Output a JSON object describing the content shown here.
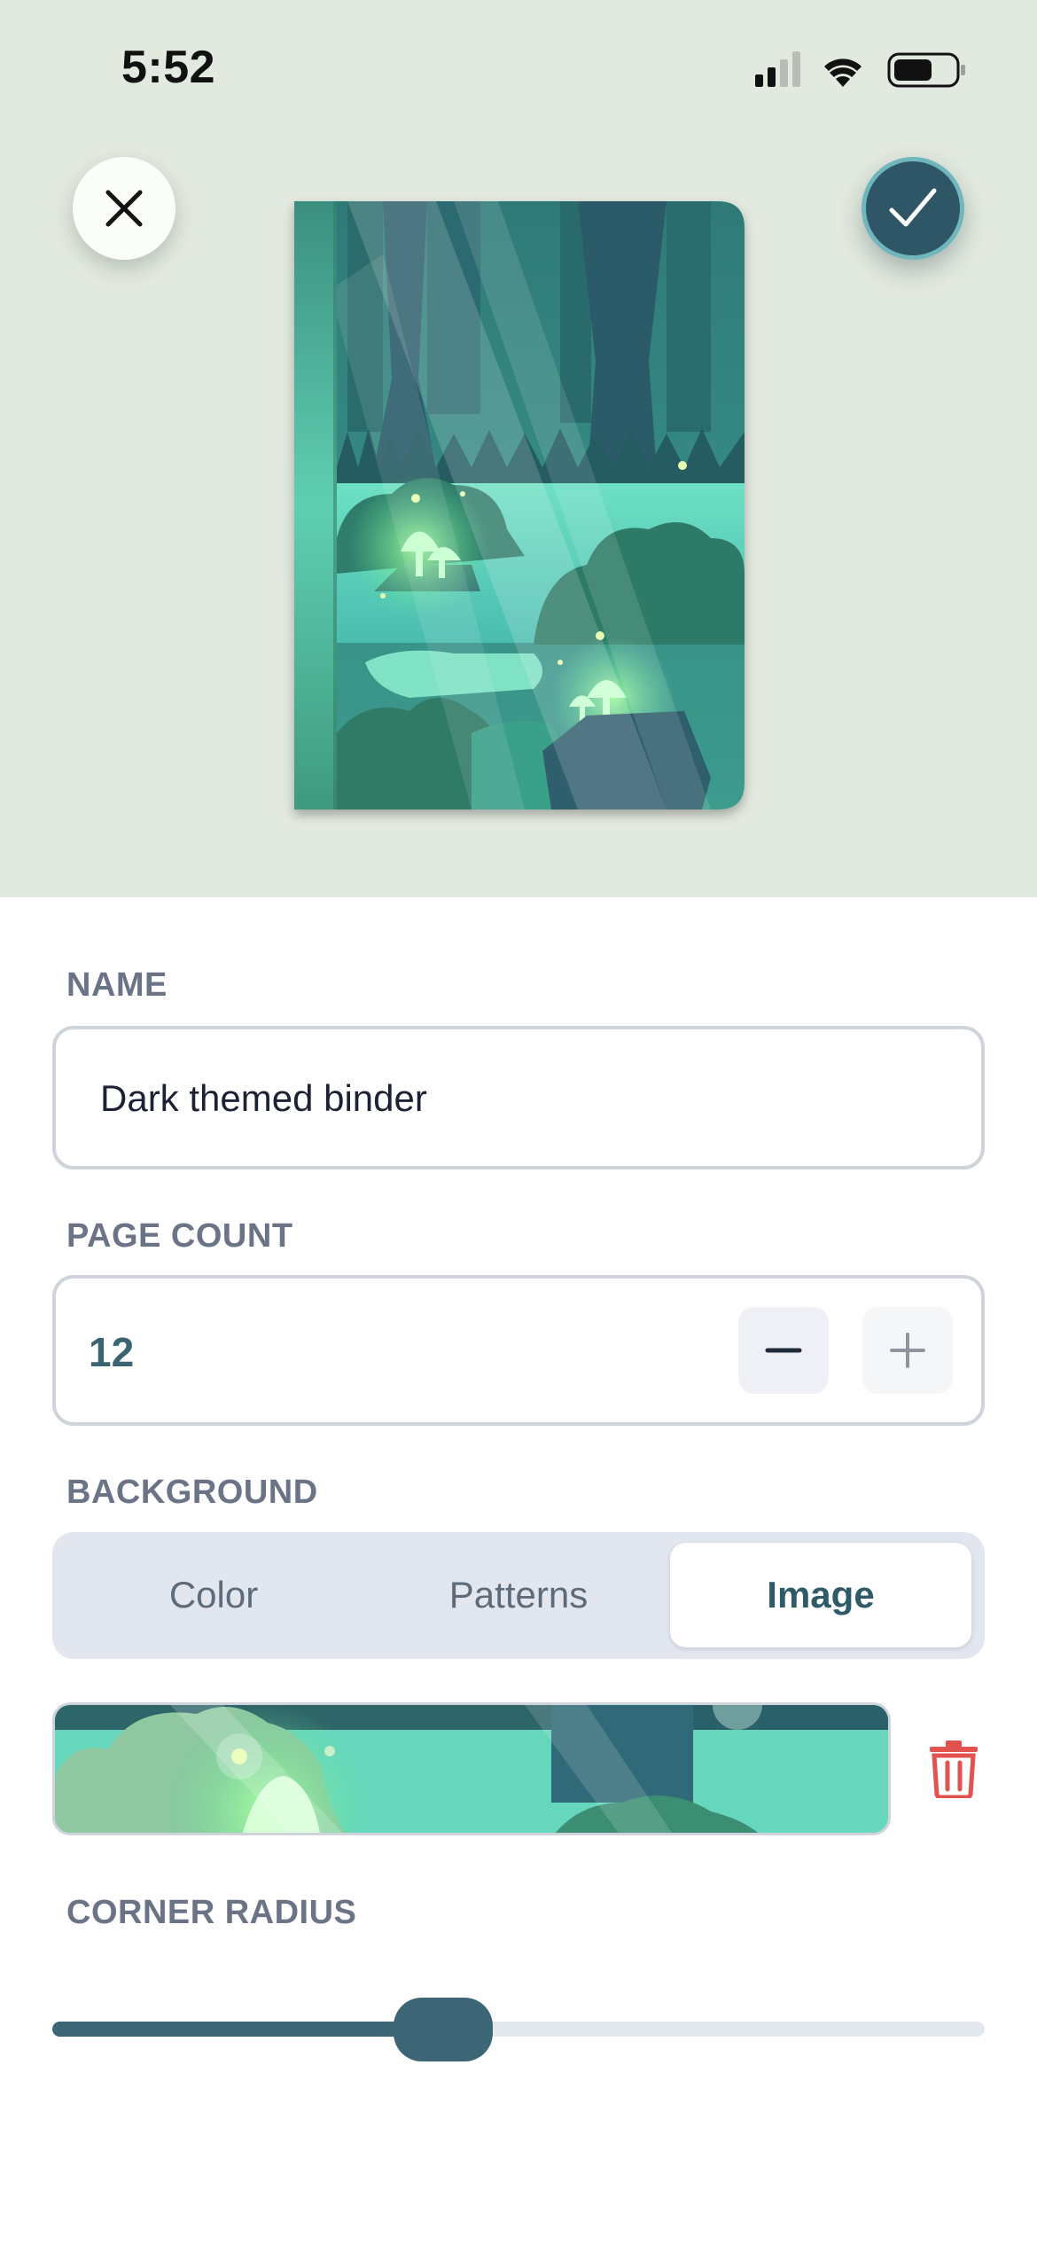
{
  "status_bar": {
    "time": "5:52"
  },
  "header": {
    "close_icon": "close-icon",
    "confirm_icon": "checkmark-icon"
  },
  "preview": {
    "cover_art": "forest-illustration"
  },
  "form": {
    "name": {
      "label": "NAME",
      "value": "Dark themed binder"
    },
    "page_count": {
      "label": "PAGE COUNT",
      "value": "12"
    },
    "background": {
      "label": "BACKGROUND",
      "options": [
        "Color",
        "Patterns",
        "Image"
      ],
      "selected": "Image"
    },
    "corner_radius": {
      "label": "CORNER RADIUS",
      "value_fraction": 0.41
    }
  },
  "colors": {
    "accent": "#3c6675",
    "delete": "#e2534f",
    "preview_bg": "#e2e9de"
  }
}
